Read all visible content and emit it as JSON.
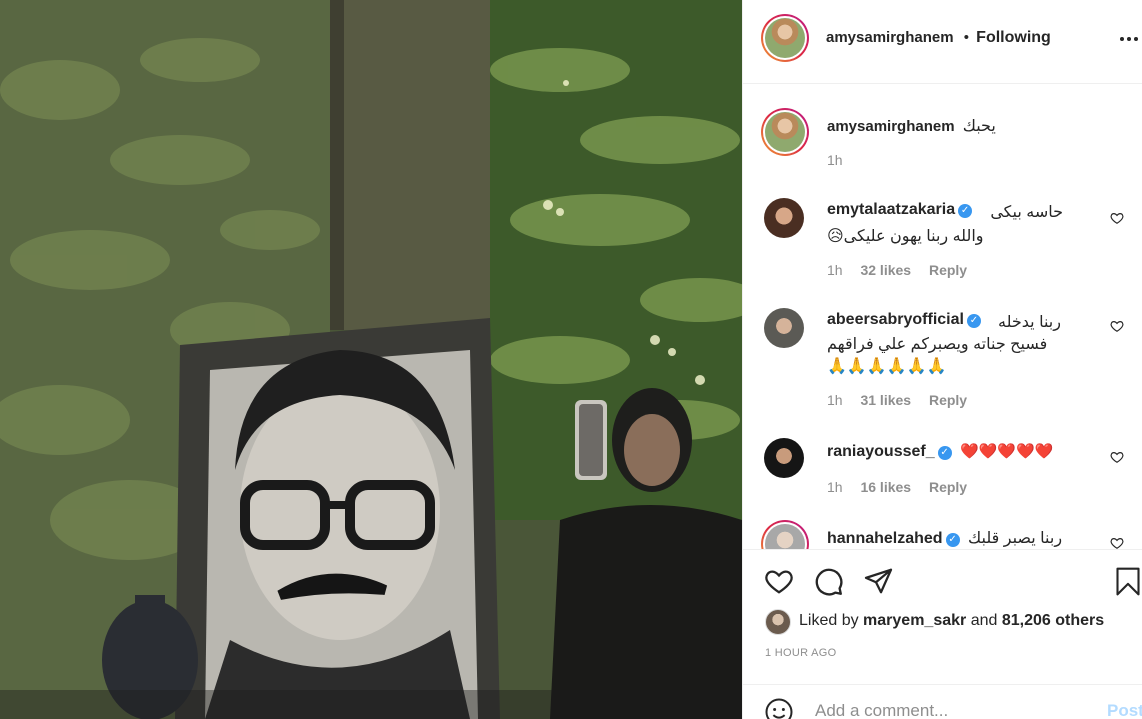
{
  "header": {
    "username": "amysamirghanem",
    "separator": "•",
    "follow_status": "Following",
    "more_icon": "more-options-icon"
  },
  "caption": {
    "username": "amysamirghanem",
    "text": "يحبك",
    "time": "1h"
  },
  "comments": [
    {
      "username": "emytalaatzakaria",
      "verified": true,
      "text_line1": "حاسه بيكى",
      "text_line2": "والله ربنا يهون عليكى😥",
      "time": "1h",
      "likes": "32 likes",
      "reply": "Reply"
    },
    {
      "username": "abeersabryofficial",
      "verified": true,
      "text_line1": "ربنا يدخله",
      "text_line2": "فسيح جناته ويصبركم علي فراقهم",
      "text_line3": "🙏🙏🙏🙏🙏🙏",
      "time": "1h",
      "likes": "31 likes",
      "reply": "Reply"
    },
    {
      "username": "raniayoussef_",
      "verified": true,
      "text_line1": "❤️❤️❤️❤️❤️",
      "time": "1h",
      "likes": "16 likes",
      "reply": "Reply"
    },
    {
      "username": "hannahelzahed",
      "verified": true,
      "text_line1": "ربنا يصبر قلبك"
    }
  ],
  "actions": {
    "like_icon": "heart-icon",
    "comment_icon": "comment-icon",
    "share_icon": "share-icon",
    "save_icon": "bookmark-icon"
  },
  "likes": {
    "prefix": "Liked by",
    "user": "maryem_sakr",
    "and": "and",
    "others": "81,206 others"
  },
  "post_time": "1 HOUR AGO",
  "add_comment": {
    "placeholder": "Add a comment...",
    "post_label": "Post",
    "emoji_icon": "emoji-icon"
  },
  "colors": {
    "accent_blue": "#3897f0",
    "post_disabled": "#b3dbff",
    "muted": "#8e8e8e",
    "text": "#262626"
  }
}
